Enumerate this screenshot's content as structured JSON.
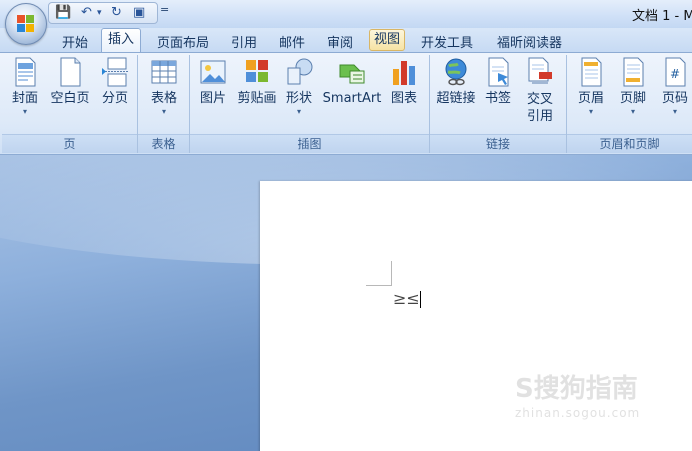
{
  "titlebar": {
    "doc_title": "文档 1 - M",
    "qat_dropdown": "=",
    "qat": {
      "save": "💾",
      "undo": "↶",
      "undo_drop": "▾",
      "redo": "↻",
      "print_preview": "▣"
    }
  },
  "tabs": [
    "开始",
    "插入",
    "页面布局",
    "引用",
    "邮件",
    "审阅",
    "视图",
    "开发工具",
    "福昕阅读器"
  ],
  "active_tab": "插入",
  "ribbon": {
    "groups": {
      "page": {
        "label": "页",
        "buttons": [
          {
            "label": "封面",
            "dropdown": "▾",
            "icon": "cover-page-icon"
          },
          {
            "label": "空白页",
            "icon": "blank-page-icon"
          },
          {
            "label": "分页",
            "icon": "page-break-icon"
          }
        ]
      },
      "table": {
        "label": "表格",
        "buttons": [
          {
            "label": "表格",
            "dropdown": "▾",
            "icon": "table-icon"
          }
        ]
      },
      "illustrations": {
        "label": "插图",
        "buttons": [
          {
            "label": "图片",
            "icon": "picture-icon"
          },
          {
            "label": "剪贴画",
            "icon": "clip-art-icon"
          },
          {
            "label": "形状",
            "dropdown": "▾",
            "icon": "shapes-icon"
          },
          {
            "label": "SmartArt",
            "icon": "smartart-icon"
          },
          {
            "label": "图表",
            "icon": "chart-icon"
          }
        ]
      },
      "links": {
        "label": "链接",
        "buttons": [
          {
            "label": "超链接",
            "icon": "hyperlink-icon"
          },
          {
            "label": "书签",
            "icon": "bookmark-icon"
          },
          {
            "label": "交叉\n引用",
            "line1": "交叉",
            "line2": "引用",
            "icon": "cross-reference-icon"
          }
        ]
      },
      "header_footer": {
        "label": "页眉和页脚",
        "buttons": [
          {
            "label": "页眉",
            "dropdown": "▾",
            "icon": "header-icon"
          },
          {
            "label": "页脚",
            "dropdown": "▾",
            "icon": "footer-icon"
          },
          {
            "label": "页码",
            "dropdown": "▾",
            "icon": "page-number-icon"
          }
        ]
      }
    }
  },
  "document": {
    "text": "≥≤"
  },
  "watermark": {
    "text": "S搜狗指南",
    "sub": "zhinan.sogou.com"
  },
  "colors": {
    "ribbon_bg": "#dde9f8",
    "workspace_bg": "#6f95c7",
    "accent": "#15355f",
    "chart_red": "#d23a2a",
    "chart_orange": "#f0a020"
  }
}
